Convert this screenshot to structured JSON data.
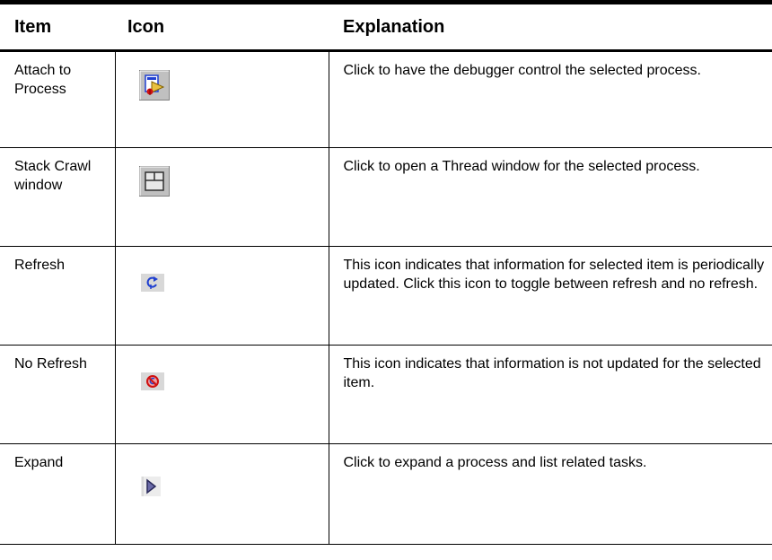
{
  "table": {
    "headers": {
      "item": "Item",
      "icon": "Icon",
      "explanation": "Explanation"
    },
    "rows": [
      {
        "item": "Attach to Process",
        "icon": "attach-to-process-icon",
        "explanation": "Click to have the debugger control the selected process."
      },
      {
        "item": "Stack Crawl window",
        "icon": "stack-crawl-window-icon",
        "explanation": "Click to open a Thread window for the selected process."
      },
      {
        "item": "Refresh",
        "icon": "refresh-icon",
        "explanation": "This icon indicates that information for selected item is periodically updated. Click this icon to toggle between refresh and no refresh."
      },
      {
        "item": "No Refresh",
        "icon": "no-refresh-icon",
        "explanation": "This icon indicates that information is not updated for the selected item."
      },
      {
        "item": "Expand",
        "icon": "expand-icon",
        "explanation": "Click to expand a process and list related tasks."
      }
    ]
  },
  "colors": {
    "icon_face": "#c0c0c0",
    "icon_blue": "#1f3fd0",
    "icon_red": "#d01010",
    "expand_arrow": "#3a3a7a"
  }
}
